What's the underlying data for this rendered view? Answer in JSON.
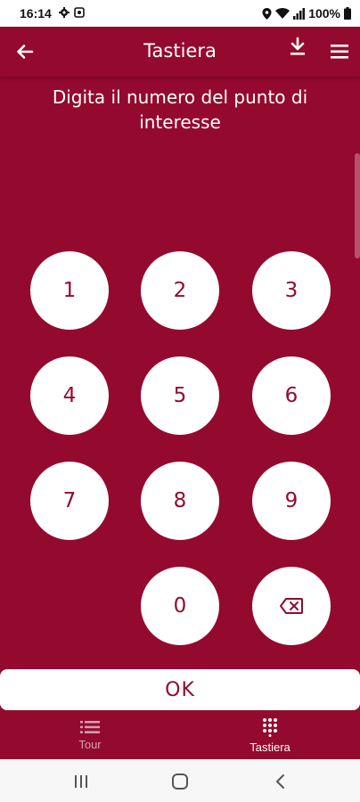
{
  "status_bar": {
    "time": "16:14",
    "battery": "100%",
    "left_icons": [
      "gear-icon",
      "notification-icon"
    ],
    "right_icons": [
      "location-icon",
      "wifi-icon",
      "signal-icon",
      "battery-icon"
    ]
  },
  "app_bar": {
    "title": "Tastiera",
    "back_icon": "arrow-left-icon",
    "download_icon": "download-icon",
    "menu_icon": "hamburger-menu-icon"
  },
  "prompt": "Digita il numero del punto di interesse",
  "keypad": {
    "keys": [
      "1",
      "2",
      "3",
      "4",
      "5",
      "6",
      "7",
      "8",
      "9",
      "0"
    ],
    "delete_icon": "backspace-icon"
  },
  "ok_button": "OK",
  "bottom_nav": {
    "items": [
      {
        "label": "Tour",
        "icon": "list-icon",
        "active": false
      },
      {
        "label": "Tastiera",
        "icon": "keypad-icon",
        "active": true
      }
    ]
  },
  "colors": {
    "primary": "#940a2e",
    "key_background": "#ffffff",
    "inactive_nav": "#d3a3b0"
  }
}
